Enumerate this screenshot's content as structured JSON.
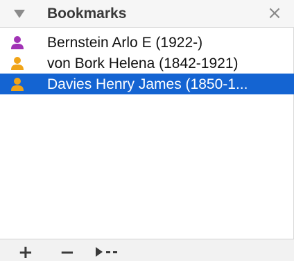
{
  "header": {
    "title": "Bookmarks",
    "close_glyph": "×",
    "disclosure_icon": "disclosure-triangle-icon"
  },
  "bookmarks": [
    {
      "label": "Bernstein Arlo E (1922-)",
      "icon": "person-icon",
      "icon_color": "#a133b5",
      "selected": false
    },
    {
      "label": "von Bork Helena (1842-1921)",
      "icon": "person-icon",
      "icon_color": "#f0a418",
      "selected": false
    },
    {
      "label": "Davies Henry James (1850-1...",
      "icon": "person-icon",
      "icon_color": "#f0a418",
      "selected": true
    }
  ],
  "footer": {
    "add_glyph": "+",
    "remove_glyph": "−",
    "action_icon": "action-menu-icon"
  },
  "colors": {
    "selection": "#1464d2",
    "header_bg": "#f6f6f6"
  }
}
